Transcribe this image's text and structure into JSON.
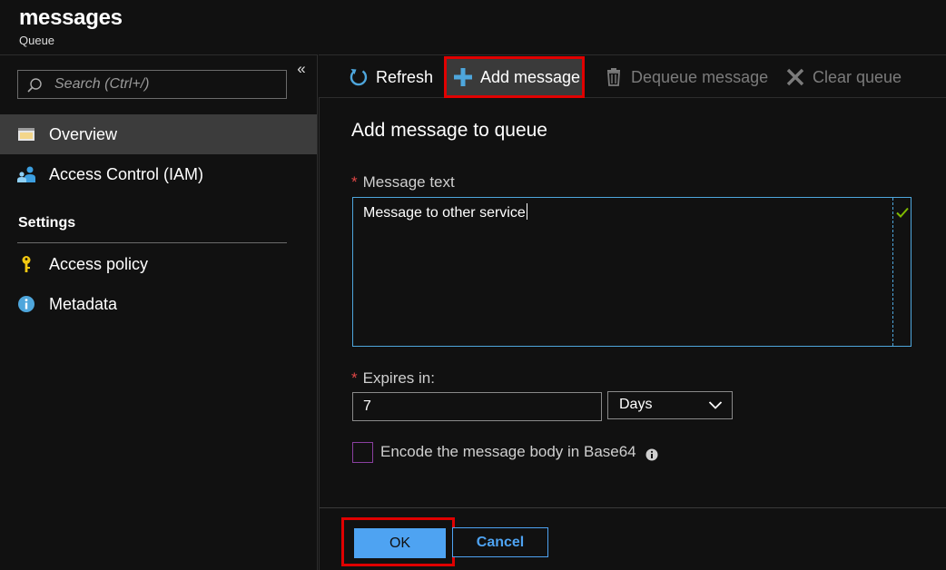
{
  "header": {
    "title": "messages",
    "subtitle": "Queue"
  },
  "sidebar": {
    "search_placeholder": "Search (Ctrl+/)",
    "collapse_glyph": "«",
    "items": [
      {
        "label": "Overview",
        "icon": "overview-icon",
        "active": true
      },
      {
        "label": "Access Control (IAM)",
        "icon": "people-icon",
        "active": false
      }
    ],
    "section_title": "Settings",
    "settings_items": [
      {
        "label": "Access policy",
        "icon": "key-icon"
      },
      {
        "label": "Metadata",
        "icon": "info-icon"
      }
    ]
  },
  "toolbar": {
    "refresh_label": "Refresh",
    "add_label": "Add message",
    "dequeue_label": "Dequeue message",
    "clear_label": "Clear queue"
  },
  "panel": {
    "title": "Add message to queue",
    "required_marker": "*",
    "message_label": "Message text",
    "message_value": "Message to other service",
    "expires_label": "Expires in:",
    "expires_value": "7",
    "expires_unit": "Days",
    "encode_label": "Encode the message body in Base64",
    "encode_checked": false
  },
  "footer": {
    "ok_label": "OK",
    "cancel_label": "Cancel"
  },
  "colors": {
    "background": "#111111",
    "accent": "#4ea3f2",
    "highlight": "#e00000",
    "required": "#e04646",
    "valid": "#7fba00"
  }
}
